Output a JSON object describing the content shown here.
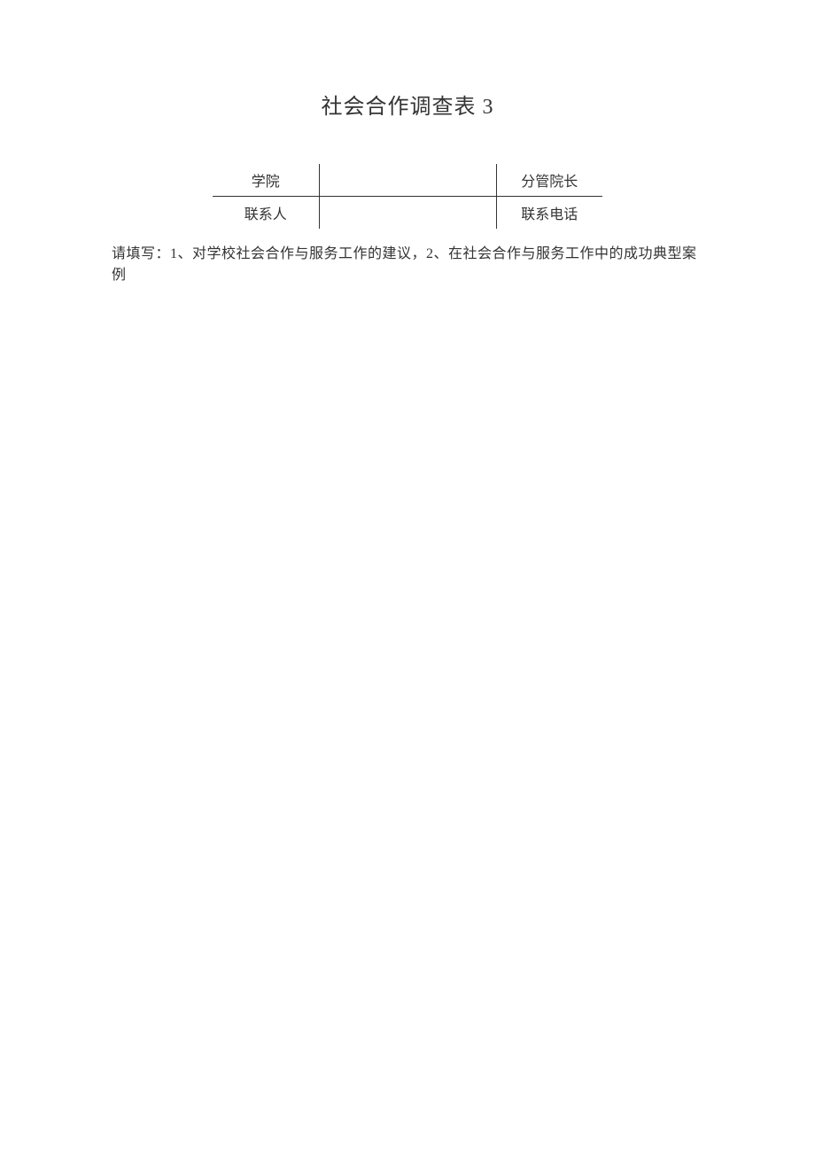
{
  "title": "社会合作调查表 3",
  "form": {
    "row1": {
      "label1": "学院",
      "value1": "",
      "label2": "分管院长"
    },
    "row2": {
      "label1": "联系人",
      "value1": "",
      "label2": "联系电话"
    }
  },
  "instruction": "请填写：1、对学校社会合作与服务工作的建议，2、在社会合作与服务工作中的成功典型案例"
}
